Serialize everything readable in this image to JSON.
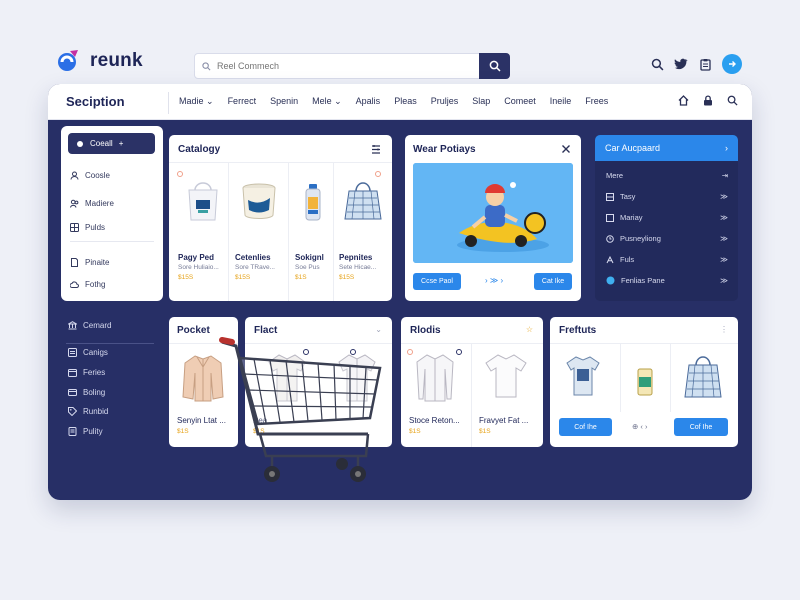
{
  "brand": {
    "name": "reunk"
  },
  "search": {
    "placeholder": "Reel Commech"
  },
  "nav": {
    "section_title": "Seciption",
    "links": [
      "Madie ⌄",
      "Ferrect",
      "Spenin",
      "Mele ⌄",
      "Apalis",
      "Pleas",
      "Pruljes",
      "Slap",
      "Comeet",
      "Ineile",
      "Frees"
    ]
  },
  "sidebar": {
    "primary_button": "Coeall",
    "items": [
      "Coosle",
      "Madiere",
      "Pulds",
      "Pinaite",
      "Fothg"
    ],
    "dark_items": [
      "Cemard",
      "Canigs",
      "Feries",
      "Boling",
      "Runbid",
      "Pulity"
    ]
  },
  "catalog": {
    "title": "Catalogy",
    "products": [
      {
        "name": "Pagy Ped",
        "sub": "Sore Huliaio...",
        "price": "$15S"
      },
      {
        "name": "Cetenlies",
        "sub": "Sore TRave...",
        "price": "$15S"
      },
      {
        "name": "Sokignl",
        "sub": "Soe Pus",
        "price": "$1S"
      },
      {
        "name": "Pepnites",
        "sub": "Sete Hicae...",
        "price": "$15S"
      }
    ]
  },
  "feature": {
    "title": "Wear Potiays",
    "button_left": "Ccse Paol",
    "pager": "› ≫ ›",
    "button_right": "Cat Ike"
  },
  "right_panel": {
    "header": "Car Aucpaard",
    "items": [
      {
        "label": "Mere",
        "value": "⇥"
      },
      {
        "label": "Tasy",
        "value": "≫"
      },
      {
        "label": "Mariay",
        "value": "≫"
      },
      {
        "label": "Pusneyliong",
        "value": "≫"
      },
      {
        "label": "Fuls",
        "value": "≫"
      },
      {
        "label": "Fenlias Pane",
        "value": "≫"
      }
    ]
  },
  "product": {
    "title": "Pocket",
    "name": "Senyin Ltat ...",
    "price": "$1S"
  },
  "flact": {
    "title": "Flact",
    "name": "Pea",
    "price": "$1S"
  },
  "rlodis": {
    "title": "Rlodis",
    "products": [
      {
        "name": "Stoce Reton...",
        "price": "$1S"
      },
      {
        "name": "Fravyet Fat ...",
        "price": "$1S"
      }
    ]
  },
  "freftuts": {
    "title": "Freftuts",
    "button_left": "Cof Ihe",
    "pager": "⊕ ‹ ›",
    "button_right": "Cof Ihe"
  },
  "colors": {
    "accent": "#2b87ea",
    "navy": "#272f66",
    "price": "#e6a31a"
  }
}
